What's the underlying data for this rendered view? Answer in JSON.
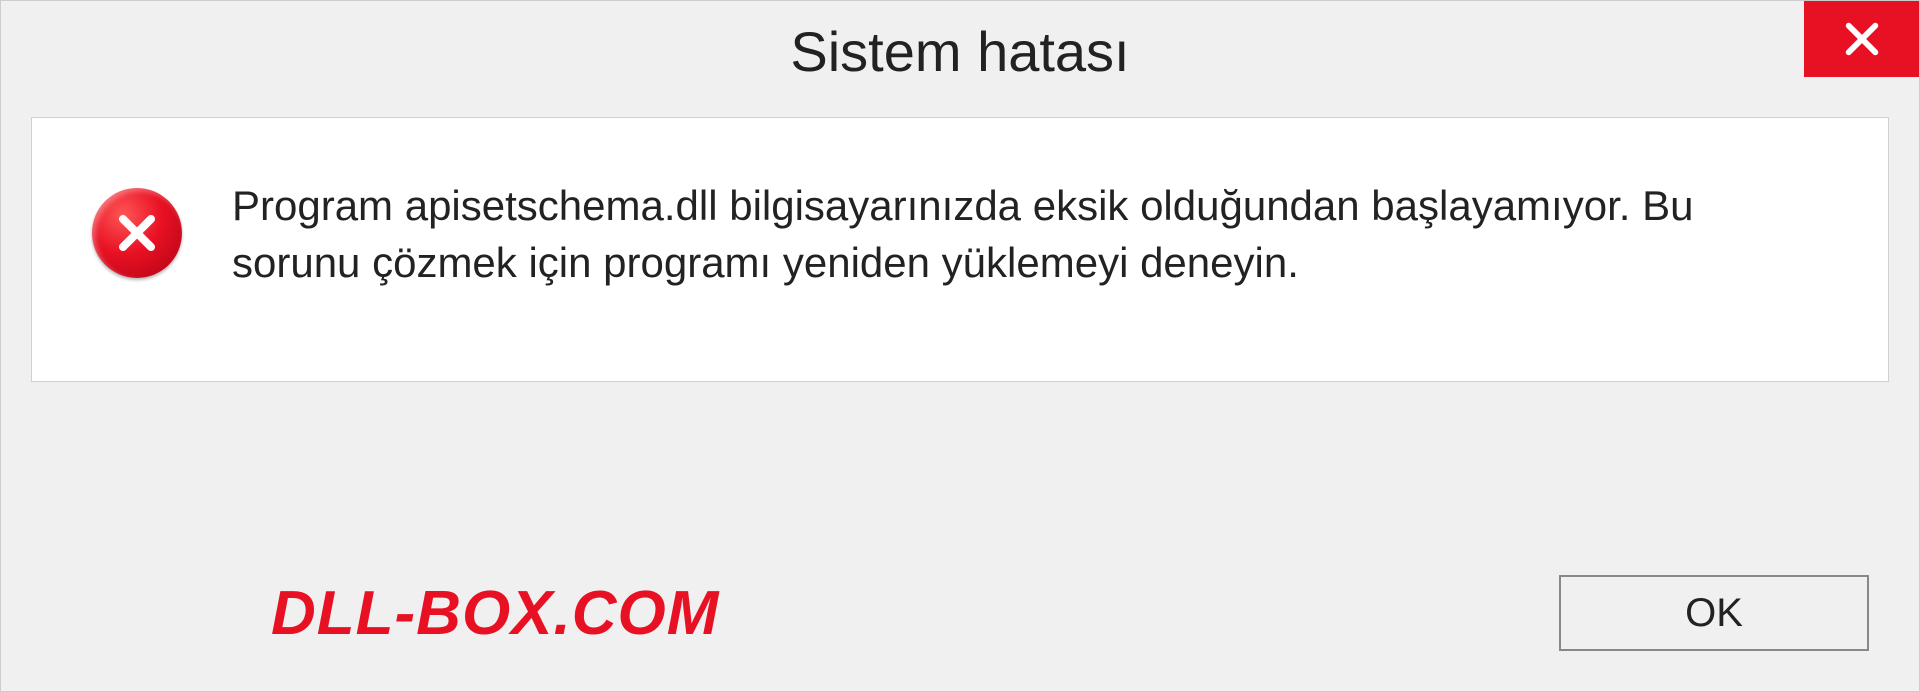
{
  "titlebar": {
    "title": "Sistem hatası"
  },
  "message": {
    "text": "Program apisetschema.dll bilgisayarınızda eksik olduğundan başlayamıyor. Bu sorunu çözmek için programı yeniden yüklemeyi deneyin."
  },
  "footer": {
    "watermark": "DLL-BOX.COM",
    "ok_label": "OK"
  },
  "colors": {
    "close_bg": "#e81123",
    "error_icon": "#e81123",
    "watermark": "#e81123"
  }
}
